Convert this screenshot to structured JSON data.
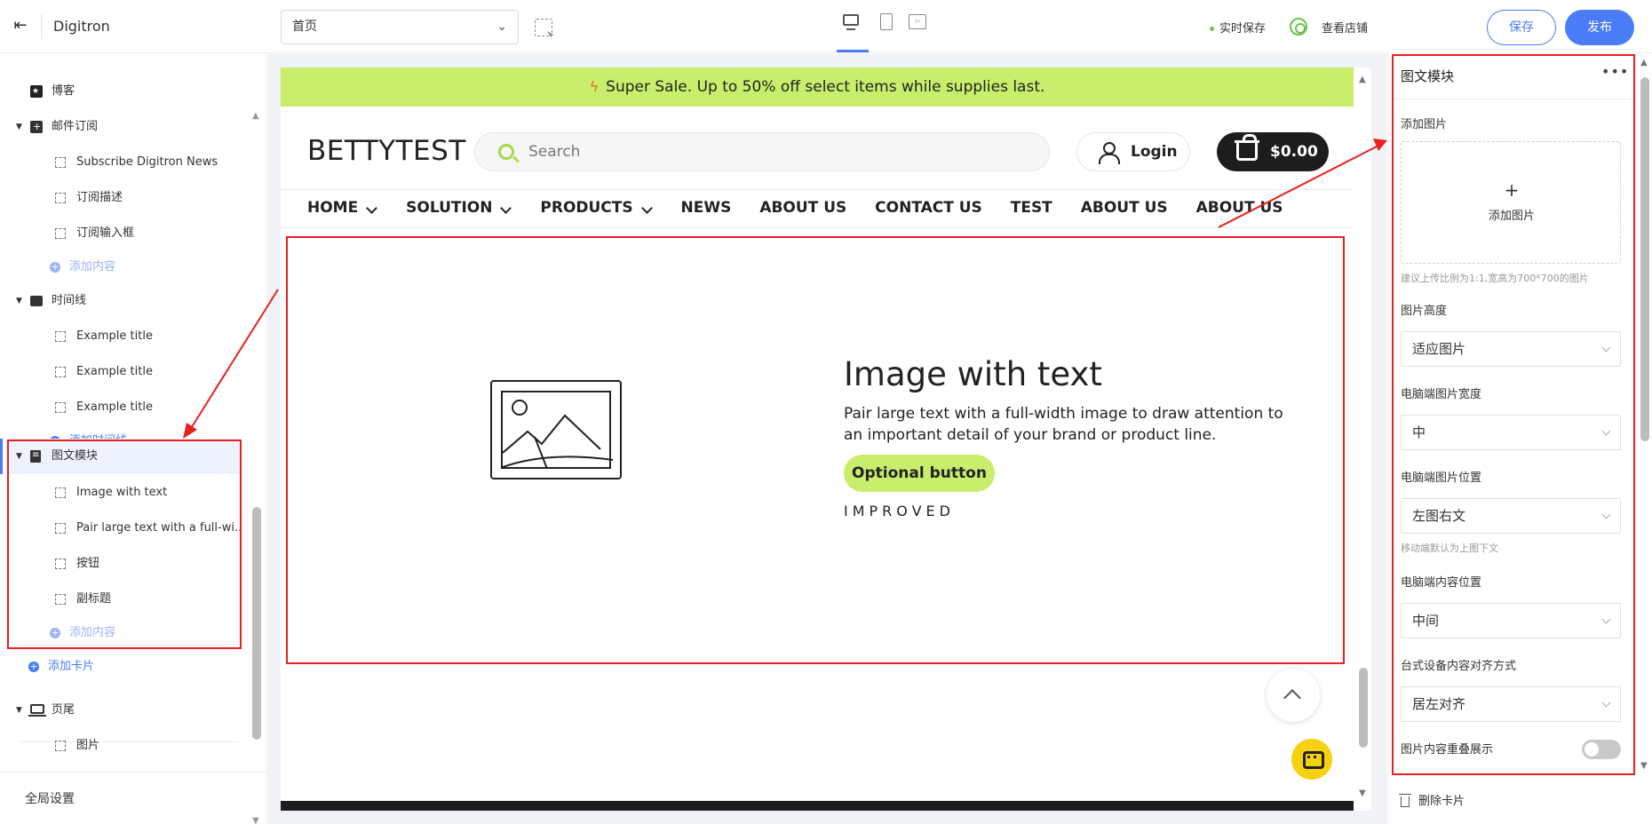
{
  "topbar": {
    "brand": "Digitron",
    "page_select": "首页",
    "save_status": "实时保存",
    "view_shop": "查看店铺",
    "save_label": "保存",
    "publish_label": "发布"
  },
  "sidebar": {
    "items": [
      {
        "label": "博客",
        "level": 1
      },
      {
        "label": "邮件订阅",
        "level": 1
      },
      {
        "label": "Subscribe Digitron News",
        "level": 2
      },
      {
        "label": "订阅描述",
        "level": 2
      },
      {
        "label": "订阅输入框",
        "level": 2
      },
      {
        "label": "添加内容",
        "level": 2,
        "type": "add"
      },
      {
        "label": "时间线",
        "level": 1
      },
      {
        "label": "Example title",
        "level": 2
      },
      {
        "label": "Example title",
        "level": 2
      },
      {
        "label": "Example title",
        "level": 2
      },
      {
        "label": "添加时间线",
        "level": 2,
        "type": "add"
      },
      {
        "label": "图文模块",
        "level": 1,
        "selected": true
      },
      {
        "label": "Image with text",
        "level": 2
      },
      {
        "label": "Pair large text with a full-wi...",
        "level": 2
      },
      {
        "label": "按钮",
        "level": 2
      },
      {
        "label": "副标题",
        "level": 2
      },
      {
        "label": "添加内容",
        "level": 2,
        "type": "add"
      },
      {
        "label": "添加卡片",
        "level": 1,
        "type": "add"
      },
      {
        "label": "页尾",
        "level": 1
      },
      {
        "label": "图片",
        "level": 2
      }
    ],
    "global_settings": "全局设置"
  },
  "preview": {
    "promo": "Super Sale. Up to 50% off select items while supplies last.",
    "logo": "BETTYTEST",
    "search_placeholder": "Search",
    "login": "Login",
    "cart": "$0.00",
    "nav": [
      "HOME",
      "SOLUTION",
      "PRODUCTS",
      "NEWS",
      "ABOUT US",
      "CONTACT US",
      "TEST",
      "ABOUT US",
      "ABOUT US"
    ],
    "section": {
      "title": "Image with text",
      "description": "Pair large text with a full-width image to draw attention to an important detail of your brand or product line.",
      "button": "Optional button",
      "subtitle": "IMPROVED"
    }
  },
  "settings": {
    "title": "图文模块",
    "add_image_label": "添加图片",
    "add_image_button": "添加图片",
    "image_hint": "建议上传比例为1:1,宽高为700*700的图片",
    "image_height_label": "图片高度",
    "image_height_value": "适应图片",
    "desktop_width_label": "电脑端图片宽度",
    "desktop_width_value": "中",
    "desktop_position_label": "电脑端图片位置",
    "desktop_position_value": "左图右文",
    "mobile_hint": "移动端默认为上图下文",
    "content_position_label": "电脑端内容位置",
    "content_position_value": "中间",
    "align_label": "台式设备内容对齐方式",
    "align_value": "居左对齐",
    "overlap_label": "图片内容重叠展示",
    "overlap_enabled": false,
    "delete_card": "删除卡片"
  },
  "colors": {
    "accent": "#4a7cf7",
    "promo_bg": "#c8ee6c",
    "highlight": "#e82020",
    "chat": "#f5d10f"
  }
}
